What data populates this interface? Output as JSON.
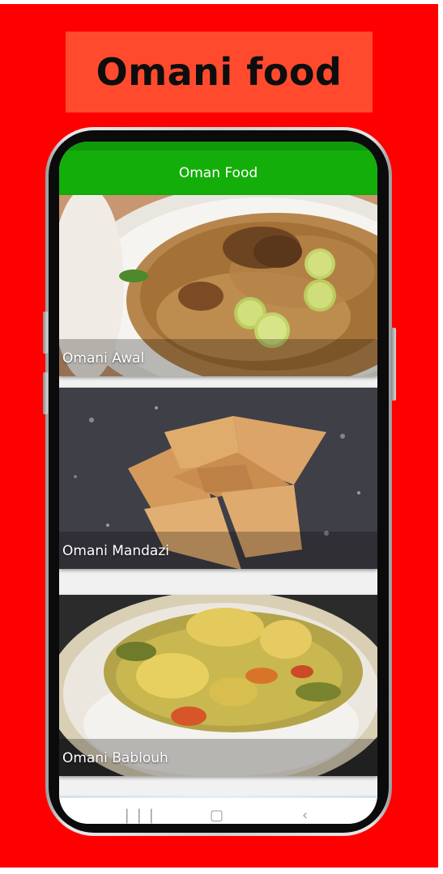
{
  "poster": {
    "title": "Omani food",
    "background_color": "#ff0000",
    "title_box_color": "#ff4a2e"
  },
  "app": {
    "app_bar_title": "Oman Food",
    "app_bar_color": "#14ae0a"
  },
  "cards": [
    {
      "label": "Omani Awal",
      "image": "rice-with-meat-and-lime-photo"
    },
    {
      "label": "Omani Mandazi",
      "image": "fried-dough-triangles-photo"
    },
    {
      "label": "Omani Bablouh",
      "image": "fish-curry-over-rice-photo"
    }
  ],
  "nav": {
    "recents_icon": "recents-icon",
    "home_icon": "home-icon",
    "back_icon": "back-icon"
  }
}
